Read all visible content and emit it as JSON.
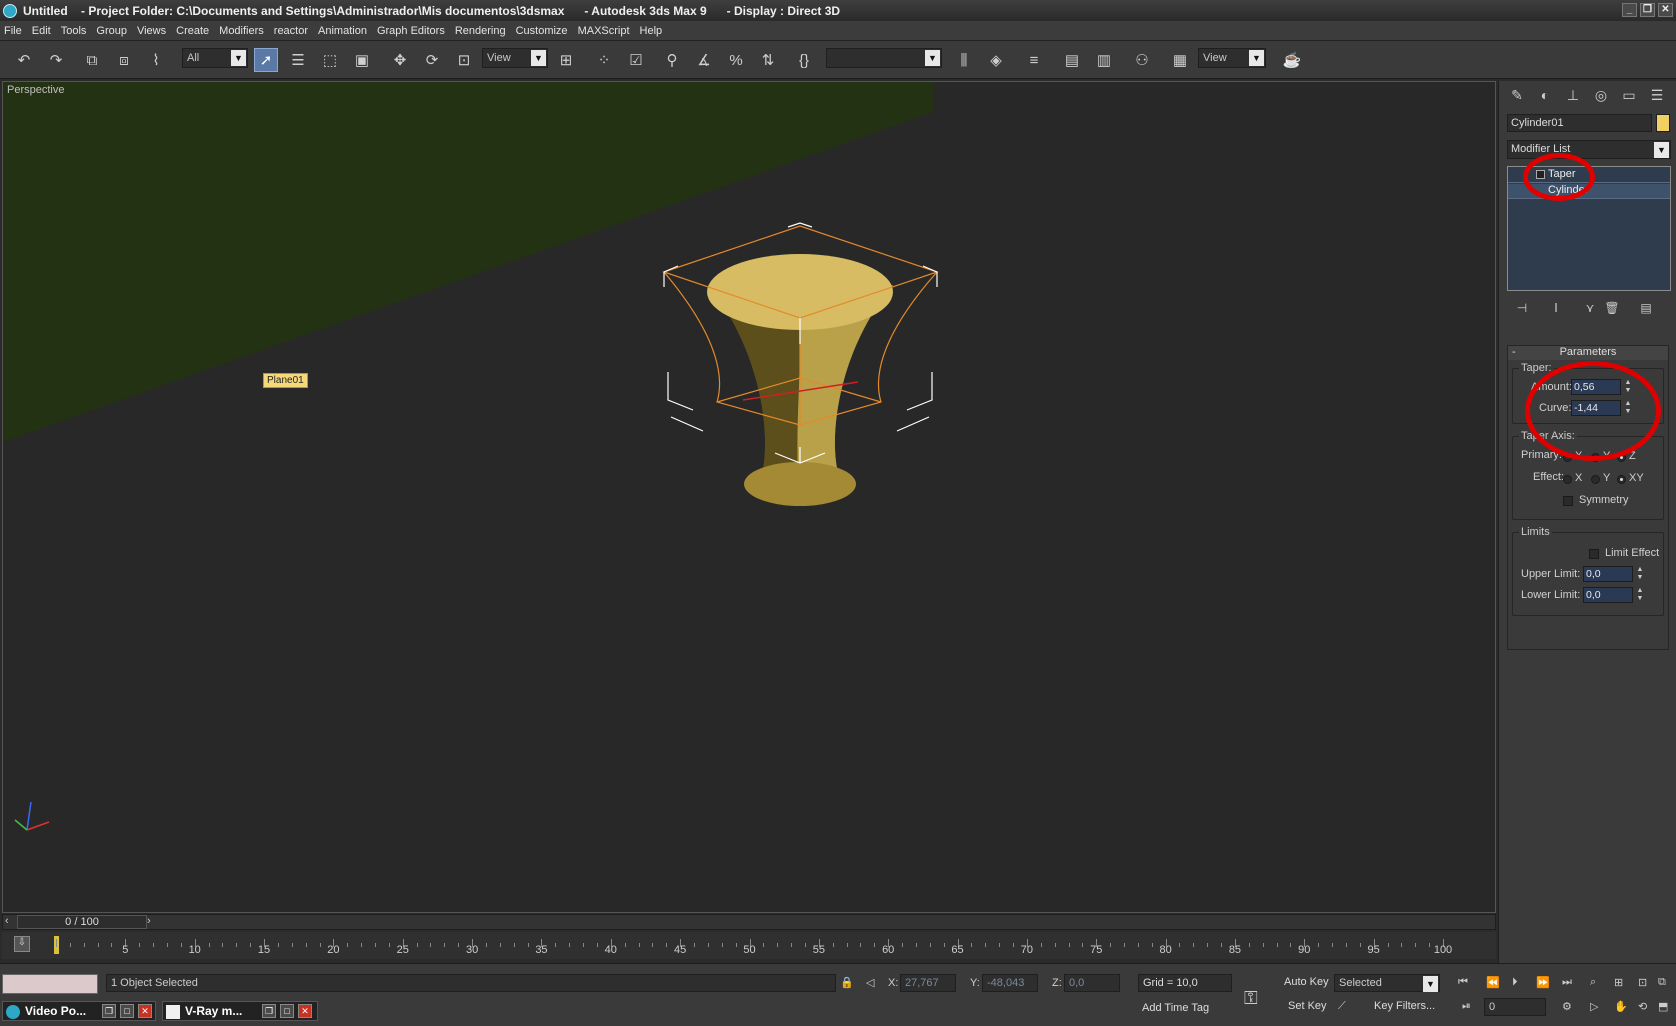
{
  "window": {
    "title": "Untitled    - Project Folder: C:\\Documents and Settings\\Administrador\\Mis documentos\\3dsmax      - Autodesk 3ds Max 9      - Display : Direct 3D",
    "controls": [
      "_",
      "❐",
      "✕"
    ]
  },
  "menu": [
    "File",
    "Edit",
    "Tools",
    "Group",
    "Views",
    "Create",
    "Modifiers",
    "reactor",
    "Animation",
    "Graph Editors",
    "Rendering",
    "Customize",
    "MAXScript",
    "Help"
  ],
  "toolbar": {
    "selection_filter": "All",
    "ref_coord": "View",
    "named_selection": "",
    "render_view": "View"
  },
  "viewport": {
    "label": "Perspective",
    "plane_tag": "Plane01"
  },
  "command_panel": {
    "object_name": "Cylinder01",
    "object_color": "#f1cf63",
    "modifier_list": "Modifier List",
    "stack": [
      "Taper",
      "Cylinder"
    ],
    "rollout_title": "Parameters",
    "taper_group": "Taper:",
    "amount_label": "Amount:",
    "amount_value": "0,56",
    "curve_label": "Curve:",
    "curve_value": "-1,44",
    "taper_axis_group": "Taper Axis:",
    "primary_label": "Primary:",
    "effect_label": "Effect:",
    "primary_options": [
      "X",
      "Y",
      "Z"
    ],
    "effect_options": [
      "X",
      "Y",
      "XY"
    ],
    "symmetry_label": "Symmetry",
    "limits_group": "Limits",
    "limit_effect_label": "Limit Effect",
    "upper_limit_label": "Upper Limit:",
    "upper_limit_value": "0,0",
    "lower_limit_label": "Lower Limit:",
    "lower_limit_value": "0,0"
  },
  "timeline": {
    "slider": "0 / 100",
    "ticks": [
      "5",
      "10",
      "15",
      "20",
      "25",
      "30",
      "35",
      "40",
      "45",
      "50",
      "55",
      "60",
      "65",
      "70",
      "75",
      "80",
      "85",
      "90",
      "95",
      "100"
    ]
  },
  "status": {
    "selection": "1 Object Selected",
    "x_label": "X:",
    "x_value": "27,767",
    "y_label": "Y:",
    "y_value": "-48,043",
    "z_label": "Z:",
    "z_value": "0,0",
    "grid": "Grid = 10,0",
    "add_time_tag": "Add Time Tag",
    "auto_key": "Auto Key",
    "set_key": "Set Key",
    "key_mode": "Selected",
    "key_filters": "Key Filters...",
    "frame": "0"
  },
  "taskbar": [
    {
      "label": "Video Po..."
    },
    {
      "label": "V-Ray m..."
    }
  ]
}
